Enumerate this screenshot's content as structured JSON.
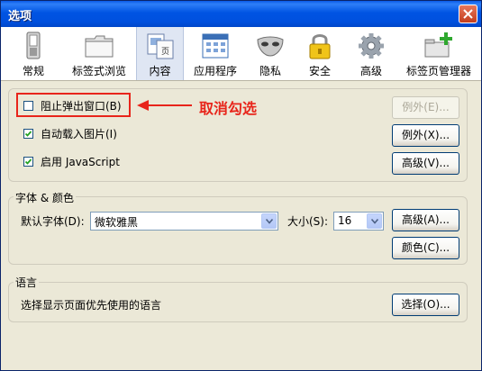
{
  "window": {
    "title": "选项"
  },
  "toolbar": {
    "tabs": [
      {
        "label": "常规",
        "icon": "switch-icon",
        "selected": false
      },
      {
        "label": "标签式浏览",
        "icon": "folder-tabs-icon",
        "selected": false
      },
      {
        "label": "内容",
        "icon": "page-content-icon",
        "selected": true
      },
      {
        "label": "应用程序",
        "icon": "applications-window-icon",
        "selected": false
      },
      {
        "label": "隐私",
        "icon": "mask-icon",
        "selected": false
      },
      {
        "label": "安全",
        "icon": "padlock-icon",
        "selected": false
      },
      {
        "label": "高级",
        "icon": "gear-icon",
        "selected": false
      },
      {
        "label": "标签页管理器",
        "icon": "tab-manager-plus-icon",
        "selected": false
      }
    ]
  },
  "content": {
    "block_popups": {
      "label": "阻止弹出窗口(B)",
      "checked": false
    },
    "exceptions_disabled_label": "例外(E)...",
    "auto_load_images": {
      "label": "自动载入图片(I)",
      "checked": true
    },
    "exceptions_label": "例外(X)...",
    "enable_javascript": {
      "label": "启用 JavaScript",
      "checked": true
    },
    "js_advanced_label": "高级(V)..."
  },
  "fonts": {
    "group_title": "字体 & 颜色",
    "default_font_label": "默认字体(D):",
    "default_font_value": "微软雅黑",
    "size_label": "大小(S):",
    "size_value": "16",
    "advanced_label": "高级(A)...",
    "colors_label": "颜色(C)..."
  },
  "language": {
    "group_title": "语言",
    "description": "选择显示页面优先使用的语言",
    "choose_label": "选择(O)..."
  },
  "annotation": {
    "text": "取消勾选",
    "color": "#e8251b"
  },
  "colors": {
    "titlebar": "#0054e3",
    "dialog_bg": "#ece9d8",
    "selected_tab": "#dfe6f3",
    "close_button": "#c23d1e"
  }
}
